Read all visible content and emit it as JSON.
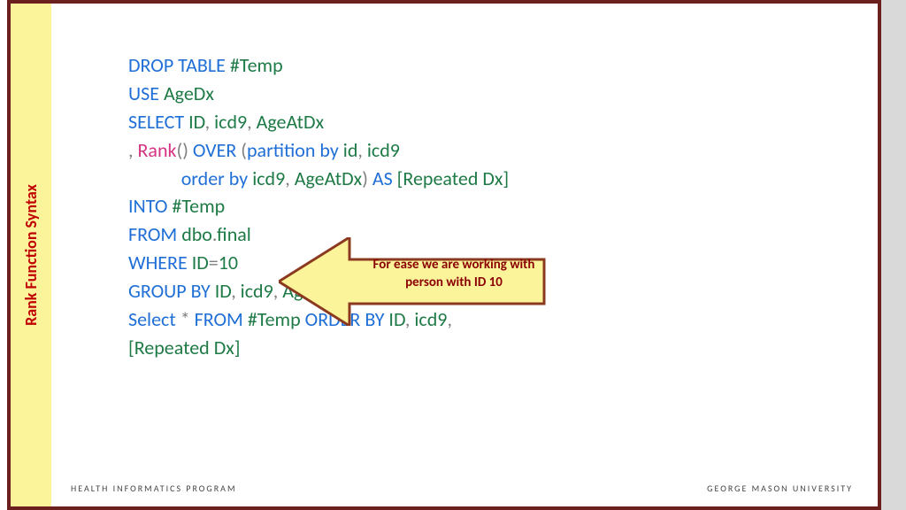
{
  "sidebar": {
    "title": "Rank Function Syntax"
  },
  "code": {
    "l1": {
      "a": "DROP TABLE",
      "b": " #Temp"
    },
    "l2": {
      "a": "USE",
      "b": " AgeDx"
    },
    "l3": {
      "a": "SELECT",
      "b": " ID",
      "c": ",",
      "d": " icd9",
      "e": ",",
      "f": " AgeAtDx"
    },
    "l4": {
      "a": ",",
      "b": " Rank",
      "c": "()",
      "d": " OVER",
      "e": " (",
      "f": "partition by",
      "g": " id",
      "h": ",",
      "i": " icd9"
    },
    "l5": {
      "pad": "            ",
      "a": "order by",
      "b": " icd9",
      "c": ",",
      "d": " AgeAtDx",
      "e": ")",
      "f": " AS",
      "g": " [Repeated Dx]"
    },
    "l6": {
      "a": "INTO",
      "b": " #Temp"
    },
    "l7": {
      "a": "FROM",
      "b": " dbo",
      "c": ".",
      "d": "final"
    },
    "l8": {
      "a": "WHERE",
      "b": " ID",
      "c": "=",
      "d": "10"
    },
    "l9": {
      "a": "GROUP BY",
      "b": " ID",
      "c": ",",
      "d": " icd9",
      "e": ",",
      "f": " AgeAtDx"
    },
    "l10": {
      "a": "Select",
      "b": " *",
      "c": " FROM",
      "d": " #Temp ",
      "e": "ORDER BY",
      "f": " ID",
      "g": ",",
      "h": " icd9",
      "i": ","
    },
    "l11": {
      "a": "[Repeated Dx]"
    }
  },
  "callout": {
    "line1": "For ease we are working with",
    "line2": "person with ID 10"
  },
  "footer": {
    "left": "HEALTH INFORMATICS PROGRAM",
    "right": "GEORGE MASON UNIVERSITY"
  }
}
